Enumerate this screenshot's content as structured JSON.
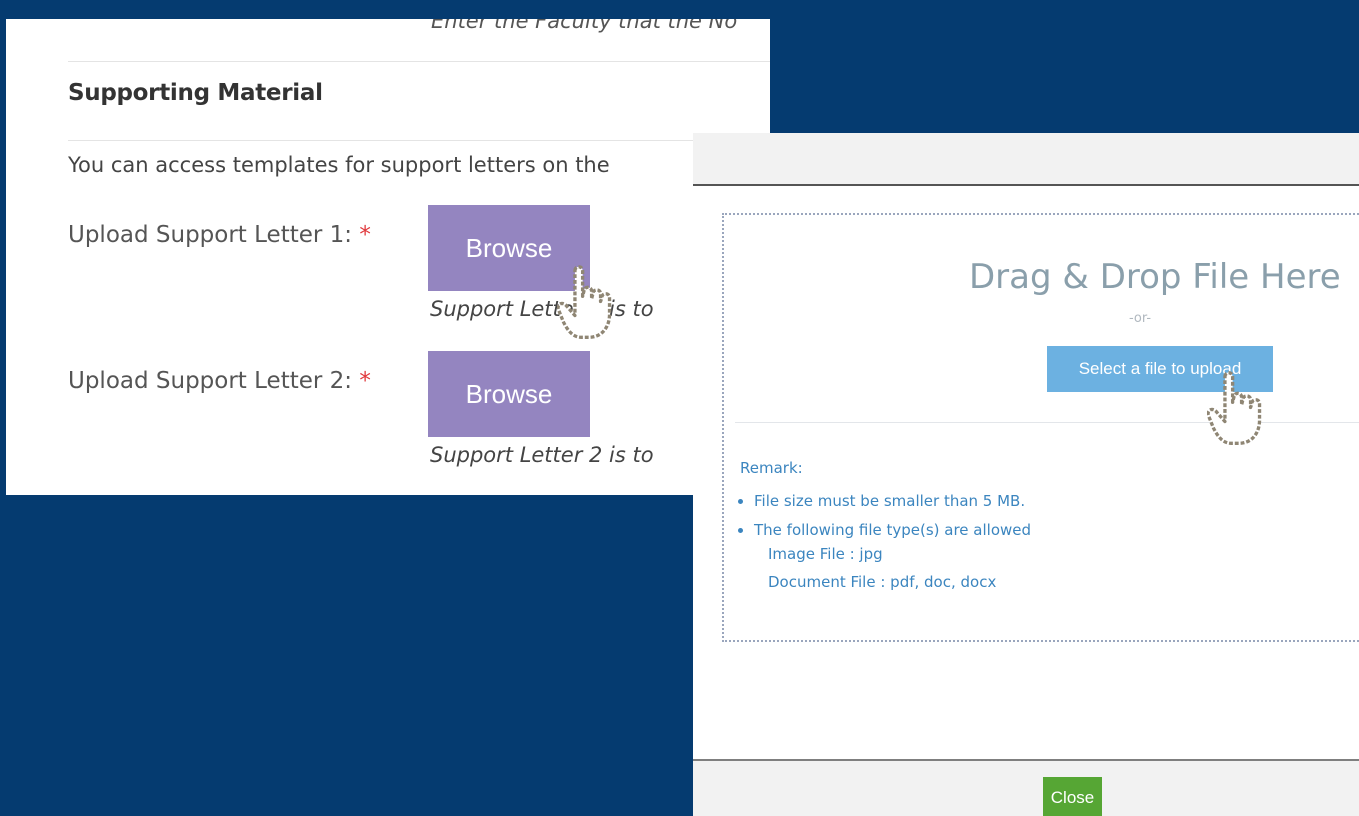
{
  "form": {
    "faculty_hint": "Enter the Faculty that the No",
    "section_title": "Supporting Material",
    "info_text": "You can access templates for support letters on the",
    "fields": [
      {
        "label": "Upload Support Letter 1:",
        "required": "*",
        "button": "Browse",
        "note": "Support Letter 1 is to"
      },
      {
        "label": "Upload Support Letter 2:",
        "required": "*",
        "button": "Browse",
        "note": "Support Letter 2 is to"
      }
    ]
  },
  "dialog": {
    "drop_title": "Drag & Drop File Here",
    "or_text": "-or-",
    "select_button": "Select a file to upload",
    "remark_label": "Remark:",
    "remarks": [
      "File size must be smaller than 5 MB.",
      "The following file type(s) are allowed"
    ],
    "file_types": [
      "Image File : jpg",
      "Document File : pdf, doc, docx"
    ],
    "close_button": "Close"
  },
  "colors": {
    "background": "#053b70",
    "browse_button": "#9485c0",
    "select_button": "#6cb1e1",
    "close_button": "#56a634",
    "remark_text": "#3b85bf",
    "required_marker": "#e0383c"
  },
  "icons": [
    "hand-pointer-icon"
  ]
}
